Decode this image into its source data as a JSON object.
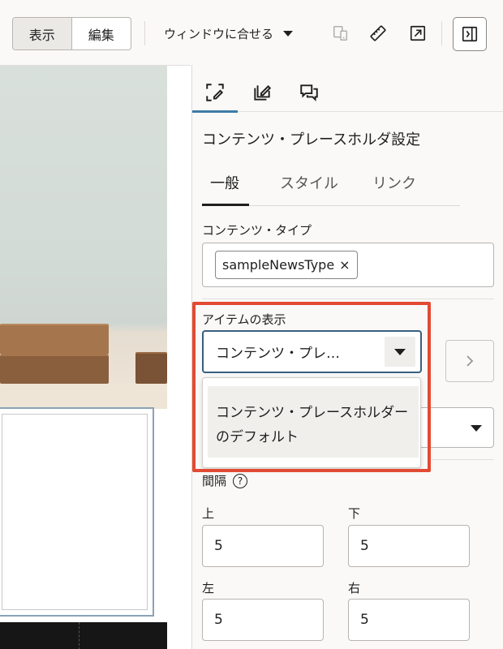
{
  "toolbar": {
    "view_label": "表示",
    "edit_label": "編集",
    "fit_label": "ウィンドウに合せる",
    "icons": [
      "device-preview-icon",
      "ruler-icon",
      "open-new-icon",
      "panel-toggle-icon"
    ]
  },
  "panel": {
    "icon_tabs": [
      "content-settings-icon",
      "edit-icon",
      "comments-icon"
    ],
    "title": "コンテンツ・プレースホルダ設定",
    "subtabs": {
      "general": "一般",
      "style": "スタイル",
      "link": "リンク"
    },
    "content_type": {
      "label": "コンテンツ・タイプ",
      "chip": "sampleNewsType",
      "chip_remove": "×"
    },
    "item_display": {
      "label": "アイテムの表示",
      "selected": "コンテンツ・プレ…",
      "option": "コンテンツ・プレースホルダーのデフォルト"
    },
    "spacing": {
      "label": "間隔",
      "help": "?",
      "top_label": "上",
      "top_value": "5",
      "bottom_label": "下",
      "bottom_value": "5",
      "left_label": "左",
      "left_value": "5",
      "right_label": "右",
      "right_value": "5"
    }
  },
  "colors": {
    "accent": "#3f7ba6",
    "focus_border": "#375f80",
    "highlight": "#e34a33"
  }
}
